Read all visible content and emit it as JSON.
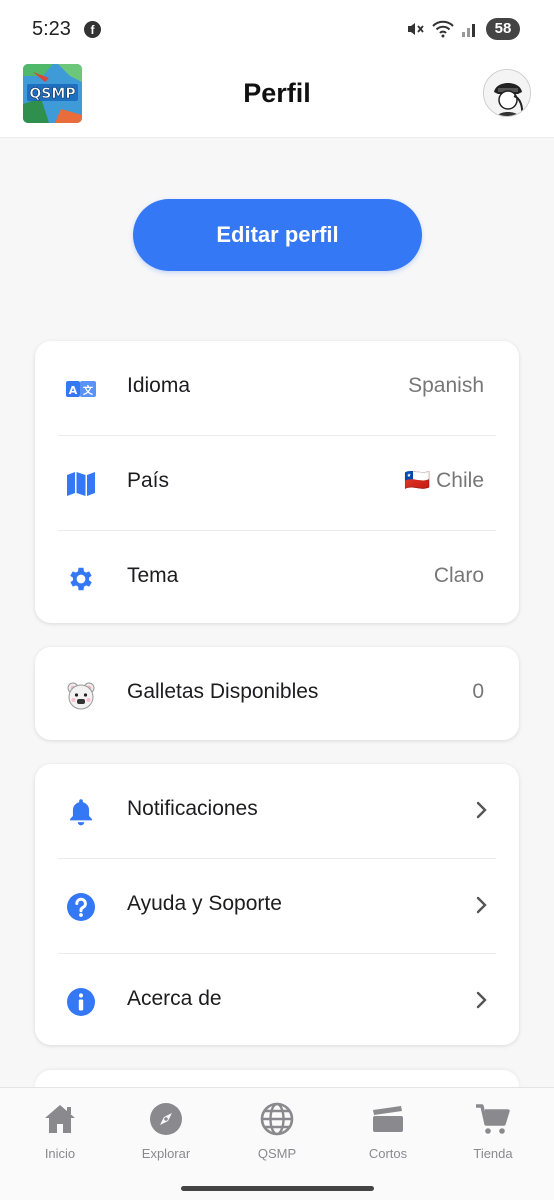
{
  "status_bar": {
    "time": "5:23",
    "battery": "58"
  },
  "header": {
    "title": "Perfil",
    "logo_text": "QSMP"
  },
  "edit_profile_label": "Editar perfil",
  "settings_card": {
    "rows": [
      {
        "label": "Idioma",
        "value": "Spanish",
        "icon": "translate-icon"
      },
      {
        "label": "País",
        "value": "🇨🇱 Chile",
        "icon": "map-icon"
      },
      {
        "label": "Tema",
        "value": "Claro",
        "icon": "gear-icon"
      }
    ]
  },
  "cookies_card": {
    "label": "Galletas Disponibles",
    "value": "0",
    "icon": "bear-icon"
  },
  "menu_card": {
    "rows": [
      {
        "label": "Notificaciones",
        "icon": "bell-icon"
      },
      {
        "label": "Ayuda y Soporte",
        "icon": "help-icon"
      },
      {
        "label": "Acerca de",
        "icon": "info-icon"
      }
    ]
  },
  "bottom_nav": {
    "items": [
      {
        "label": "Inicio",
        "icon": "home-icon"
      },
      {
        "label": "Explorar",
        "icon": "compass-icon"
      },
      {
        "label": "QSMP",
        "icon": "globe-icon"
      },
      {
        "label": "Cortos",
        "icon": "clapperboard-icon"
      },
      {
        "label": "Tienda",
        "icon": "cart-icon"
      }
    ]
  },
  "colors": {
    "accent": "#3478f6",
    "nav_icon": "#8a8a8e",
    "text_secondary": "#777777"
  }
}
